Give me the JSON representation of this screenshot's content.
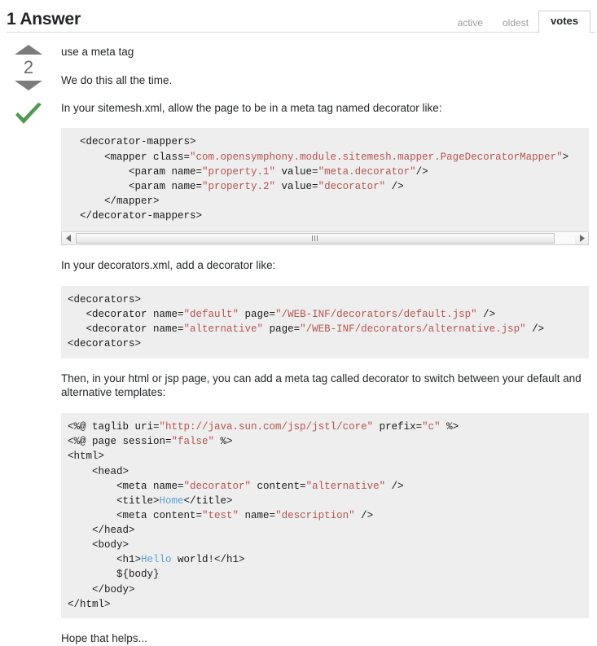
{
  "header": {
    "title": "1 Answer",
    "tabs": [
      {
        "label": "active",
        "selected": false
      },
      {
        "label": "oldest",
        "selected": false
      },
      {
        "label": "votes",
        "selected": true
      }
    ]
  },
  "answer": {
    "vote_count": "2",
    "accepted": true,
    "accent_colors": {
      "arrow": "#7b7b7b",
      "vote_count": "#6a6a6a",
      "accepted_check": "#4e9a51",
      "code_background": "#eeeeee",
      "code_string": "#b85450",
      "code_text_node": "#5a9fd4"
    },
    "paragraphs": {
      "p1": "use a meta tag",
      "p2": "We do this all the time.",
      "p3": "In your sitemesh.xml, allow the page to be in a meta tag named decorator like:",
      "p4": "In your decorators.xml, add a decorator like:",
      "p5": "Then, in your html or jsp page, you can add a meta tag called decorator to switch between your default and alternative templates:",
      "p6": "Hope that helps..."
    },
    "code_blocks": {
      "block1": {
        "has_scrollbar": true,
        "lines": [
          [
            {
              "t": "  <decorator-mappers>",
              "c": "plain"
            }
          ],
          [
            {
              "t": "      <mapper class=",
              "c": "plain"
            },
            {
              "t": "\"com.opensymphony.module.sitemesh.mapper.PageDecoratorMapper\"",
              "c": "str"
            },
            {
              "t": ">",
              "c": "plain"
            }
          ],
          [
            {
              "t": "          <param name=",
              "c": "plain"
            },
            {
              "t": "\"property.1\"",
              "c": "str"
            },
            {
              "t": " value=",
              "c": "plain"
            },
            {
              "t": "\"meta.decorator\"",
              "c": "str"
            },
            {
              "t": "/>",
              "c": "plain"
            }
          ],
          [
            {
              "t": "          <param name=",
              "c": "plain"
            },
            {
              "t": "\"property.2\"",
              "c": "str"
            },
            {
              "t": " value=",
              "c": "plain"
            },
            {
              "t": "\"decorator\"",
              "c": "str"
            },
            {
              "t": " />",
              "c": "plain"
            }
          ],
          [
            {
              "t": "      </mapper>",
              "c": "plain"
            }
          ],
          [
            {
              "t": "  </decorator-mappers>",
              "c": "plain"
            }
          ]
        ]
      },
      "block2": {
        "has_scrollbar": false,
        "lines": [
          [
            {
              "t": "<decorators>",
              "c": "plain"
            }
          ],
          [
            {
              "t": "   <decorator name=",
              "c": "plain"
            },
            {
              "t": "\"default\"",
              "c": "str"
            },
            {
              "t": " page=",
              "c": "plain"
            },
            {
              "t": "\"/WEB-INF/decorators/default.jsp\"",
              "c": "str"
            },
            {
              "t": " />",
              "c": "plain"
            }
          ],
          [
            {
              "t": "   <decorator name=",
              "c": "plain"
            },
            {
              "t": "\"alternative\"",
              "c": "str"
            },
            {
              "t": " page=",
              "c": "plain"
            },
            {
              "t": "\"/WEB-INF/decorators/alternative.jsp\"",
              "c": "str"
            },
            {
              "t": " />",
              "c": "plain"
            }
          ],
          [
            {
              "t": "<decorators>",
              "c": "plain"
            }
          ]
        ]
      },
      "block3": {
        "has_scrollbar": false,
        "lines": [
          [
            {
              "t": "<%@ taglib uri=",
              "c": "plain"
            },
            {
              "t": "\"http://java.sun.com/jsp/jstl/core\"",
              "c": "str"
            },
            {
              "t": " prefix=",
              "c": "plain"
            },
            {
              "t": "\"c\"",
              "c": "str"
            },
            {
              "t": " %>",
              "c": "plain"
            }
          ],
          [
            {
              "t": "<%@ page session=",
              "c": "plain"
            },
            {
              "t": "\"false\"",
              "c": "str"
            },
            {
              "t": " %>",
              "c": "plain"
            }
          ],
          [
            {
              "t": "<html>",
              "c": "plain"
            }
          ],
          [
            {
              "t": "    <head>",
              "c": "plain"
            }
          ],
          [
            {
              "t": "        <meta name=",
              "c": "plain"
            },
            {
              "t": "\"decorator\"",
              "c": "str"
            },
            {
              "t": " content=",
              "c": "plain"
            },
            {
              "t": "\"alternative\"",
              "c": "str"
            },
            {
              "t": " />",
              "c": "plain"
            }
          ],
          [
            {
              "t": "        <title>",
              "c": "plain"
            },
            {
              "t": "Home",
              "c": "txt"
            },
            {
              "t": "</title>",
              "c": "plain"
            }
          ],
          [
            {
              "t": "        <meta content=",
              "c": "plain"
            },
            {
              "t": "\"test\"",
              "c": "str"
            },
            {
              "t": " name=",
              "c": "plain"
            },
            {
              "t": "\"description\"",
              "c": "str"
            },
            {
              "t": " />",
              "c": "plain"
            }
          ],
          [
            {
              "t": "    </head>",
              "c": "plain"
            }
          ],
          [
            {
              "t": "    <body>",
              "c": "plain"
            }
          ],
          [
            {
              "t": "        <h1>",
              "c": "plain"
            },
            {
              "t": "Hello",
              "c": "txt"
            },
            {
              "t": " world!</h1>",
              "c": "plain"
            }
          ],
          [
            {
              "t": "        ${body}",
              "c": "plain"
            }
          ],
          [
            {
              "t": "    </body>",
              "c": "plain"
            }
          ],
          [
            {
              "t": "</html>",
              "c": "plain"
            }
          ]
        ]
      }
    }
  }
}
